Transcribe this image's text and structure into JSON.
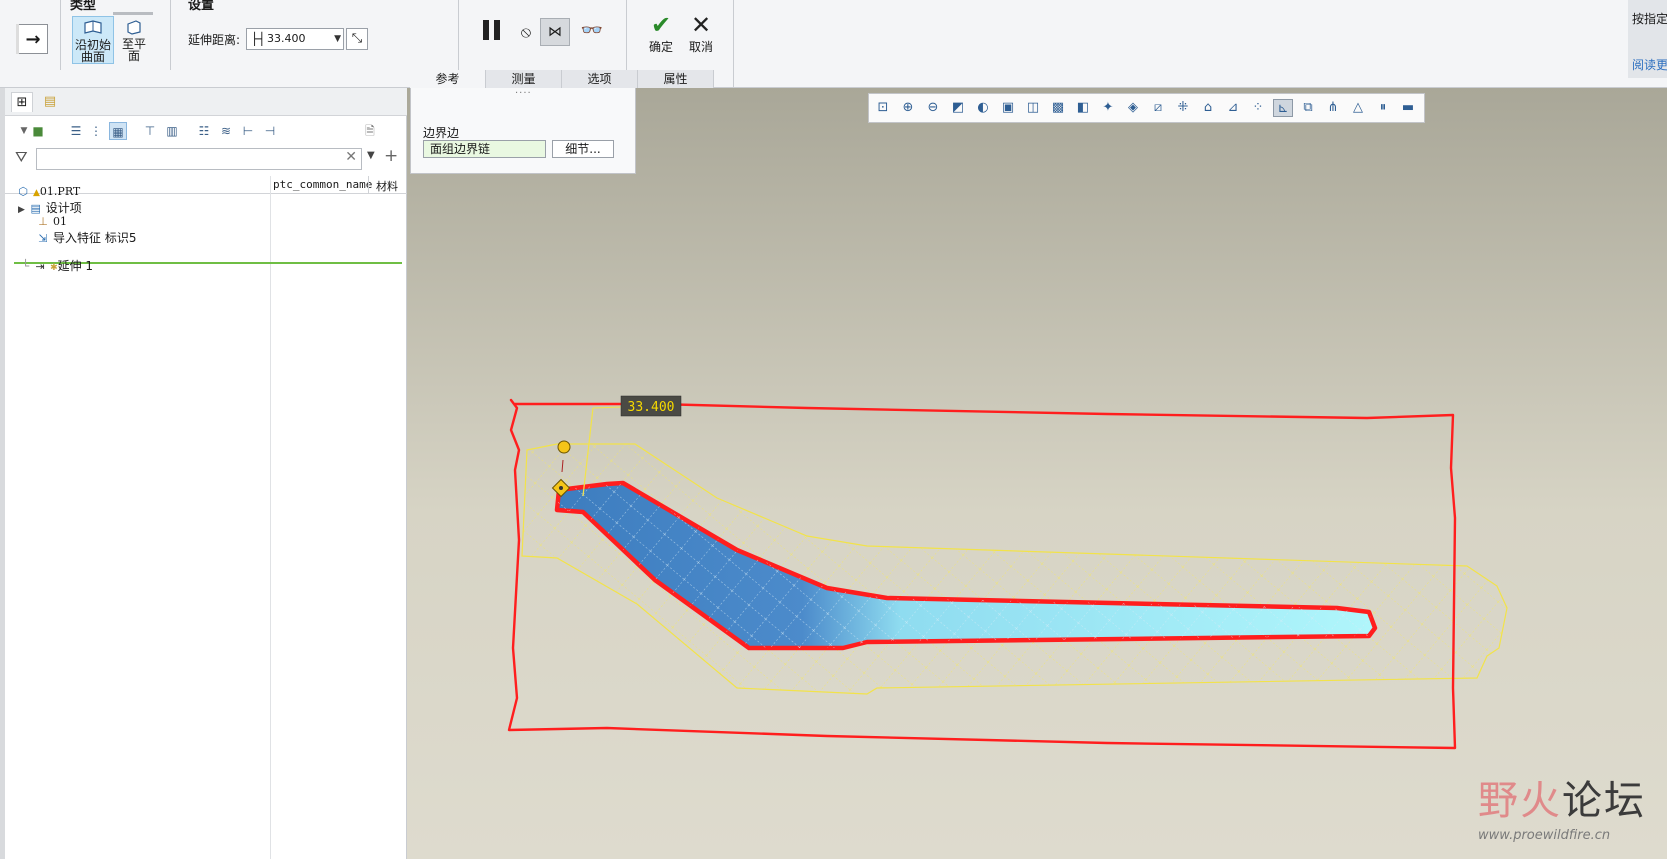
{
  "ribbon": {
    "type_group_title": "类型",
    "settings_group_title": "设置",
    "type_buttons": [
      {
        "label": "沿初始\n曲面",
        "active": true
      },
      {
        "label": "至平\n面",
        "active": false
      }
    ],
    "extend_distance_label": "延伸距离:",
    "extend_distance_value": "33.400",
    "confirm_label": "确定",
    "cancel_label": "取消",
    "tabs": [
      "参考",
      "测量",
      "选项",
      "属性"
    ],
    "right_panel_top": "按指定",
    "right_panel_link": "阅读更"
  },
  "model_tree": {
    "column_headers": [
      "ptc_common_name",
      "材料"
    ],
    "rows": [
      {
        "icon": "part-icon",
        "label": "01.PRT"
      },
      {
        "icon": "design-items-icon",
        "label": "设计项"
      },
      {
        "icon": "csys-icon",
        "label": "01"
      },
      {
        "icon": "import-feature-icon",
        "label": "导入特征 标识5"
      },
      {
        "icon": "extend-feature-icon",
        "label": "延伸 1"
      }
    ]
  },
  "reference_panel": {
    "boundary_label": "边界边",
    "chain_value": "面组边界链",
    "details_button": "细节..."
  },
  "viewport": {
    "dimension_tag": "33.400",
    "colors": {
      "boundary_red": "#ff1e1e",
      "preview_yellow": "#f2e34a",
      "surface_blue": "#4a8ccc",
      "surface_cyan": "#a8f4fb"
    }
  },
  "watermark": {
    "left_char": "野火",
    "right_chars": "论坛",
    "url": "www.proewildfire.cn"
  }
}
